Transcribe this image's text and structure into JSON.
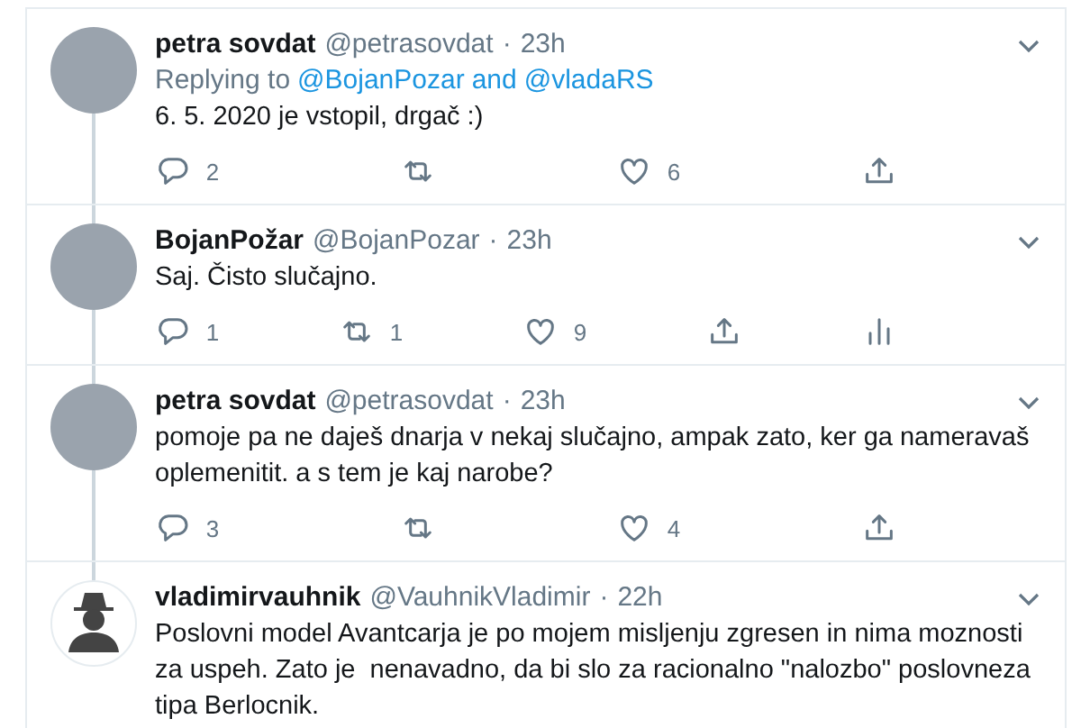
{
  "tweets": [
    {
      "name": "petra sovdat",
      "handle": "@petrasovdat",
      "separator": "·",
      "time": "23h",
      "avatar": {
        "kind": "photo"
      },
      "replying": {
        "prefix": "Replying to",
        "links": [
          "@BojanPozar",
          "@vladaRS"
        ],
        "joiner": "and"
      },
      "text": "6. 5. 2020 je vstopil, drgač :)",
      "actions": [
        {
          "kind": "reply",
          "count": "2"
        },
        {
          "kind": "retweet"
        },
        {
          "kind": "like",
          "count": "6"
        },
        {
          "kind": "share"
        }
      ]
    },
    {
      "name": "BojanPožar",
      "handle": "@BojanPozar",
      "separator": "·",
      "time": "23h",
      "avatar": {
        "kind": "photo"
      },
      "text": "Saj. Čisto slučajno.",
      "actions": [
        {
          "kind": "reply",
          "count": "1"
        },
        {
          "kind": "retweet",
          "count": "1"
        },
        {
          "kind": "like",
          "count": "9"
        },
        {
          "kind": "share"
        },
        {
          "kind": "analytics"
        }
      ]
    },
    {
      "name": "petra sovdat",
      "handle": "@petrasovdat",
      "separator": "·",
      "time": "23h",
      "avatar": {
        "kind": "photo"
      },
      "text": "pomoje pa ne daješ dnarja v nekaj slučajno, ampak zato, ker ga nameravaš oplemenitit. a s tem je kaj narobe?",
      "actions": [
        {
          "kind": "reply",
          "count": "3"
        },
        {
          "kind": "retweet"
        },
        {
          "kind": "like",
          "count": "4"
        },
        {
          "kind": "share"
        }
      ]
    },
    {
      "name": "vladimirvauhnik",
      "handle": "@VauhnikVladimir",
      "separator": "·",
      "time": "22h",
      "avatar": {
        "kind": "silhouette"
      },
      "text": "Poslovni model Avantcarja je po mojem misljenju zgresen in nima moznosti za uspeh. Zato je  nenavadno, da bi slo za racionalno \"nalozbo\" poslovneza tipa Berlocnik."
    }
  ]
}
